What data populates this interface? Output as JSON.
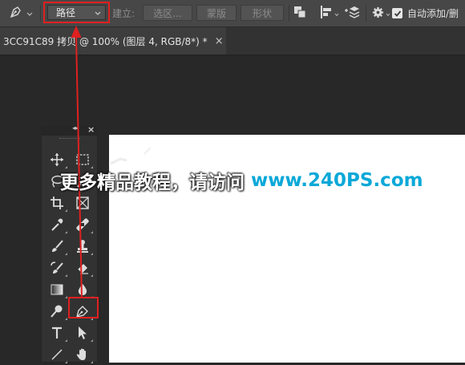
{
  "options_bar": {
    "mode_select": "路径",
    "make_label": "建立:",
    "selection_button": "选区...",
    "mask_button": "蒙版",
    "shape_button": "形状",
    "auto_add_delete_label": "自动添加/删",
    "auto_add_delete_checked": true
  },
  "document_tab": {
    "title": "3CC91C89 拷贝 @ 100% (图层 4, RGB/8*) *",
    "close_glyph": "×"
  },
  "toolbox": {
    "collapse_glyph": "◂▸",
    "close_glyph": "×"
  },
  "watermark": {
    "chinese_text": "更多精品教程，请访问",
    "url_text": "www.240PS.com"
  },
  "colors": {
    "highlight_red": "#e02020",
    "watermark_blue": "#0aa8d8"
  }
}
